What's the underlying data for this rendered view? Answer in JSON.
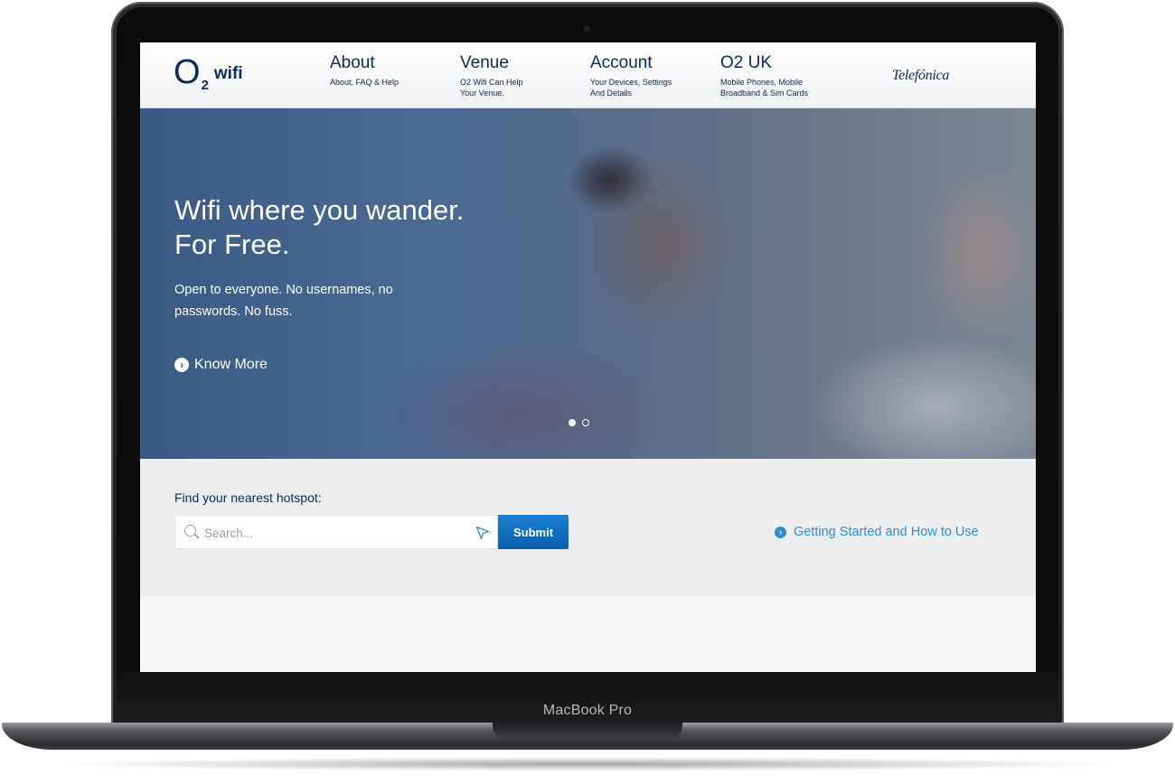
{
  "device": {
    "model_label": "MacBook Pro"
  },
  "header": {
    "logo": {
      "o": "O",
      "two": "2",
      "wifi": "wifi"
    },
    "nav": [
      {
        "title": "About",
        "subtitle": "About, FAQ & Help"
      },
      {
        "title": "Venue",
        "subtitle": "O2 Wifi Can Help Your Venue."
      },
      {
        "title": "Account",
        "subtitle": "Your Devices, Settings And Details"
      },
      {
        "title": "O2 UK",
        "subtitle": "Mobile Phones, Mobile Broadband & Sim Cards"
      }
    ],
    "partner_brand": "Telefónica"
  },
  "hero": {
    "title_line1": "Wifi where you wander.",
    "title_line2": "For Free.",
    "subtitle": "Open to everyone. No usernames, no passwords. No fuss.",
    "cta_label": "Know More",
    "carousel": {
      "slides": 2,
      "active": 0
    }
  },
  "search": {
    "label": "Find your nearest hotspot:",
    "placeholder": "Search...",
    "value": "",
    "submit_label": "Submit",
    "help_link": "Getting Started and How to Use"
  },
  "colors": {
    "brand_navy": "#0b2b60",
    "accent_blue": "#2e8fd6",
    "submit_blue": "#0a6cc0",
    "hero_overlay": "#3a5a86"
  },
  "icons": [
    "search-icon",
    "location-arrow-icon",
    "chevron-right-circle-icon"
  ]
}
